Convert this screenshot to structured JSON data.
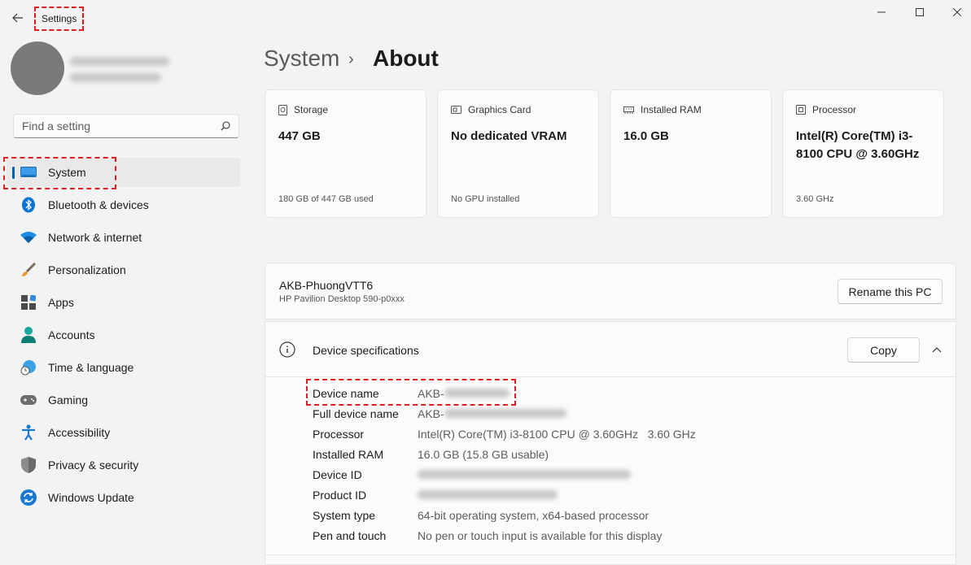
{
  "app": {
    "title": "Settings"
  },
  "search": {
    "placeholder": "Find a setting"
  },
  "sidebar": {
    "items": [
      {
        "label": "System",
        "icon": "system-icon",
        "active": true
      },
      {
        "label": "Bluetooth & devices",
        "icon": "bluetooth-icon"
      },
      {
        "label": "Network & internet",
        "icon": "wifi-icon"
      },
      {
        "label": "Personalization",
        "icon": "brush-icon"
      },
      {
        "label": "Apps",
        "icon": "apps-icon"
      },
      {
        "label": "Accounts",
        "icon": "accounts-icon"
      },
      {
        "label": "Time & language",
        "icon": "globe-clock-icon"
      },
      {
        "label": "Gaming",
        "icon": "gamepad-icon"
      },
      {
        "label": "Accessibility",
        "icon": "accessibility-icon"
      },
      {
        "label": "Privacy & security",
        "icon": "shield-icon"
      },
      {
        "label": "Windows Update",
        "icon": "update-icon"
      }
    ]
  },
  "breadcrumb": {
    "parent": "System",
    "separator": "›",
    "current": "About"
  },
  "cards": [
    {
      "title": "Storage",
      "value": "447 GB",
      "sub": "180 GB of 447 GB used",
      "icon": "storage-icon"
    },
    {
      "title": "Graphics Card",
      "value": "No dedicated VRAM",
      "sub": "No GPU installed",
      "icon": "graphics-card-icon"
    },
    {
      "title": "Installed RAM",
      "value": "16.0 GB",
      "sub": "",
      "icon": "ram-icon"
    },
    {
      "title": "Processor",
      "value": "Intel(R) Core(TM) i3-8100 CPU @ 3.60GHz",
      "sub": "3.60 GHz",
      "icon": "processor-icon"
    }
  ],
  "pc": {
    "name": "AKB-PhuongVTT6",
    "model": "HP Pavilion Desktop 590-p0xxx",
    "rename_label": "Rename this PC"
  },
  "specs": {
    "title": "Device specifications",
    "copy_label": "Copy",
    "rows": [
      {
        "label": "Device name",
        "value": "AKB-"
      },
      {
        "label": "Full device name",
        "value": "AKB-"
      },
      {
        "label": "Processor",
        "value": "Intel(R) Core(TM) i3-8100 CPU @ 3.60GHz   3.60 GHz"
      },
      {
        "label": "Installed RAM",
        "value": "16.0 GB (15.8 GB usable)"
      },
      {
        "label": "Device ID",
        "value": ""
      },
      {
        "label": "Product ID",
        "value": ""
      },
      {
        "label": "System type",
        "value": "64-bit operating system, x64-based processor"
      },
      {
        "label": "Pen and touch",
        "value": "No pen or touch input is available for this display"
      }
    ]
  },
  "colors": {
    "accent": "#005fb8",
    "annotation": "#e02020"
  }
}
